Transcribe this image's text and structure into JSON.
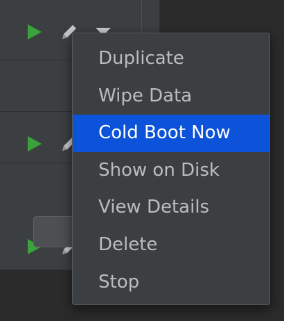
{
  "device_list": {
    "rows": [
      {
        "play_icon": "play-icon",
        "edit_icon": "pencil-icon",
        "menu_icon": "chevron-down-icon"
      },
      {
        "play_icon": "play-icon",
        "edit_icon": "pencil-icon"
      },
      {
        "play_icon": "play-icon",
        "edit_icon": "pencil-icon"
      }
    ]
  },
  "context_menu": {
    "items": [
      {
        "label": "Duplicate",
        "selected": false
      },
      {
        "label": "Wipe Data",
        "selected": false
      },
      {
        "label": "Cold Boot Now",
        "selected": true
      },
      {
        "label": "Show on Disk",
        "selected": false
      },
      {
        "label": "View Details",
        "selected": false
      },
      {
        "label": "Delete",
        "selected": false
      },
      {
        "label": "Stop",
        "selected": false
      }
    ]
  },
  "colors": {
    "menu_background": "#3c3f41",
    "selection": "#0d53d9",
    "run_accent": "#3ba33b",
    "menu_text": "#bcbcbc"
  }
}
